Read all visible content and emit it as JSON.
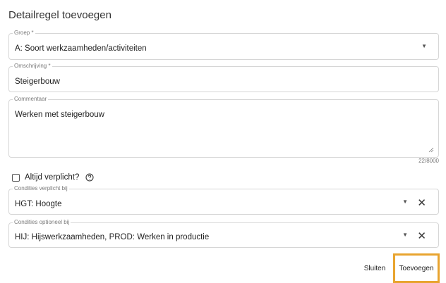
{
  "dialog": {
    "title": "Detailregel toevoegen"
  },
  "fields": {
    "groep": {
      "label": "Groep *",
      "value": "A: Soort werkzaamheden/activiteiten"
    },
    "omschrijving": {
      "label": "Omschrijving *",
      "value": "Steigerbouw"
    },
    "commentaar": {
      "label": "Commentaar",
      "value": "Werken met steigerbouw",
      "counter": "22/8000"
    },
    "altijd_verplicht": {
      "label": "Altijd verplicht?",
      "checked": false,
      "help_icon": "question-circle-icon"
    },
    "condities_verplicht": {
      "label": "Condities verplicht bij",
      "value": "HGT: Hoogte"
    },
    "condities_optioneel": {
      "label": "Condities optioneel bij",
      "value": "HIJ: Hijswerkzaamheden, PROD: Werken in productie"
    }
  },
  "actions": {
    "sluiten": "Sluiten",
    "toevoegen": "Toevoegen"
  },
  "colors": {
    "highlight": "#e8a42f",
    "border": "#d6d6d6"
  }
}
